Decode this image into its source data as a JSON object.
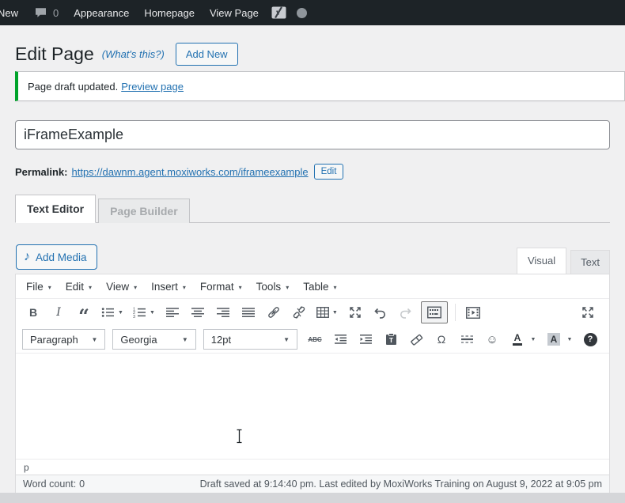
{
  "admin_bar": {
    "new_label": "New",
    "comment_count": "0",
    "menu_items": [
      "Appearance",
      "Homepage",
      "View Page"
    ],
    "icons": [
      "comment-bubble-icon",
      "yoast-seo-icon",
      "gray-circle-icon"
    ]
  },
  "page_header": {
    "title": "Edit Page",
    "whats_this_link": "(What's this?)",
    "add_new_button": "Add New"
  },
  "notice": {
    "message": "Page draft updated.",
    "link_label": "Preview page"
  },
  "title_field": {
    "value": "iFrameExample"
  },
  "permalink": {
    "label": "Permalink:",
    "url": "https://dawnm.agent.moxiworks.com/iframeexample",
    "edit_button": "Edit"
  },
  "editor_tabs": [
    {
      "label": "Text Editor",
      "active": true
    },
    {
      "label": "Page Builder",
      "active": false
    }
  ],
  "media_toolbar": {
    "add_media_button": "Add Media"
  },
  "mode_tabs": [
    {
      "label": "Visual",
      "active": true
    },
    {
      "label": "Text",
      "active": false
    }
  ],
  "menubar": {
    "items": [
      "File",
      "Edit",
      "View",
      "Insert",
      "Format",
      "Tools",
      "Table"
    ]
  },
  "toolbar_row1_icons": [
    "bold",
    "italic",
    "blockquote",
    "bulleted-list",
    "numbered-list",
    "align-left",
    "align-center",
    "align-right",
    "justify",
    "insert-link",
    "remove-link",
    "table",
    "distraction-free",
    "undo",
    "redo",
    "toolbar-toggle",
    "video-playlist",
    "fullscreen"
  ],
  "toolbar_row2": {
    "paragraph_select": "Paragraph",
    "font_select": "Georgia",
    "size_select": "12pt",
    "icons": [
      "strikethrough",
      "outdent",
      "indent",
      "paste-as-text",
      "clear-formatting",
      "special-character",
      "horizontal-rule",
      "emoticons",
      "text-color",
      "background-color",
      "help"
    ]
  },
  "editor": {
    "content": "",
    "element_path": "p"
  },
  "status_bar": {
    "word_count_label": "Word count:",
    "word_count_value": "0",
    "save_status": "Draft saved at 9:14:40 pm. Last edited by MoxiWorks Training on August 9, 2022 at 9:05 pm"
  },
  "glyphs": {
    "menu_caret": "▾",
    "dropdown_caret": "▼",
    "bold": "B",
    "italic": "I",
    "blockquote": "“",
    "omega": "Ω",
    "smiley": "☺",
    "strikethrough_sample": "ABC",
    "color_letter": "A",
    "help": "?",
    "media_note": "♪"
  },
  "colors": {
    "accent_blue": "#2271b1",
    "notice_green": "#00a32a",
    "admin_bar_bg": "#1d2327",
    "icon_gray": "#50575e"
  }
}
